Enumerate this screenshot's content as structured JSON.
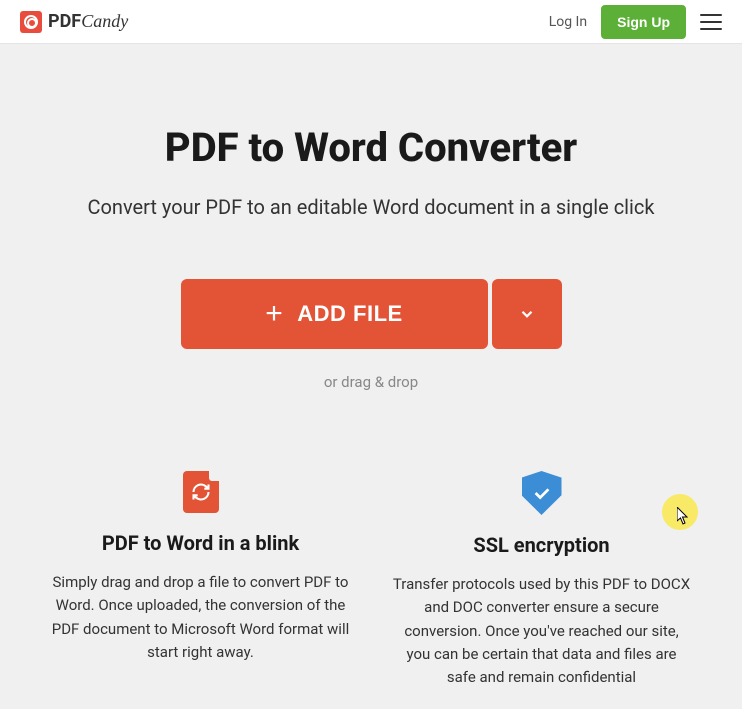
{
  "header": {
    "brand_pdf": "PDF",
    "brand_candy": "Candy",
    "login_label": "Log In",
    "signup_label": "Sign Up"
  },
  "hero": {
    "title": "PDF to Word Converter",
    "subtitle": "Convert your PDF to an editable Word document in a single click",
    "add_file_label": "ADD FILE",
    "drag_text": "or drag & drop"
  },
  "features": [
    {
      "title": "PDF to Word in a blink",
      "description": "Simply drag and drop a file to convert PDF to Word. Once uploaded, the conversion of the PDF document to Microsoft Word format will start right away."
    },
    {
      "title": "SSL encryption",
      "description": "Transfer protocols used by this PDF to DOCX and DOC converter ensure a secure conversion. Once you've reached our site, you can be certain that data and files are safe and remain confidential"
    }
  ]
}
